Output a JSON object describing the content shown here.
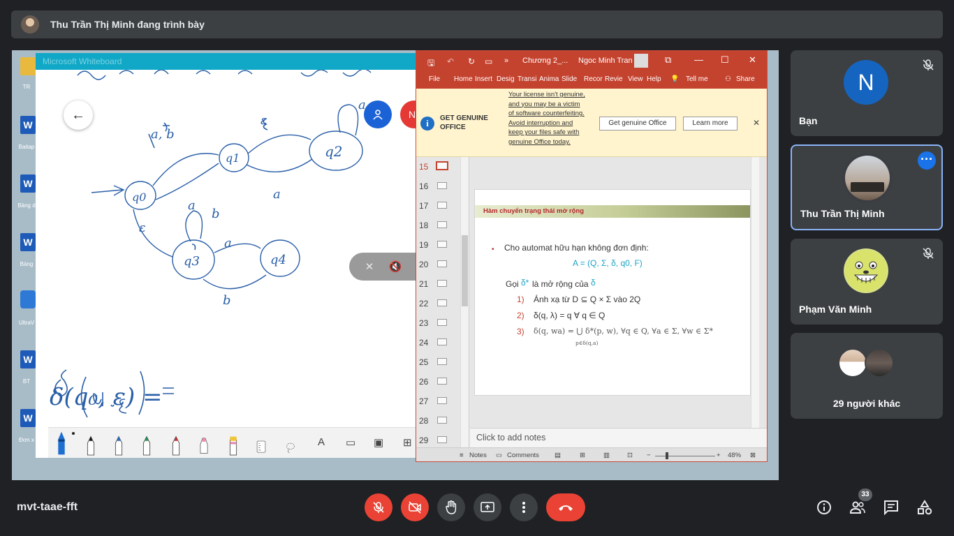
{
  "banner": {
    "presenter_text": "Thu Trần Thị Minh đang trình bày"
  },
  "desktop": {
    "icons": [
      {
        "label": "TR",
        "type": "folder"
      },
      {
        "label": "Baitap",
        "type": "word"
      },
      {
        "label": "Bảng d",
        "type": "word"
      },
      {
        "label": "Bảng",
        "type": "word"
      },
      {
        "label": "UltraV",
        "type": "app"
      },
      {
        "label": "BT",
        "type": "word"
      },
      {
        "label": "Đơn x",
        "type": "word"
      }
    ]
  },
  "whiteboard": {
    "title": "Microsoft Whiteboard",
    "user_initial": "N",
    "math_expression": "δ(q₀, ε) =",
    "state_labels": [
      "q0",
      "q1",
      "q2",
      "q3",
      "q4"
    ],
    "edge_labels": [
      "a, b",
      "ε",
      "a",
      "a",
      "ε",
      "b",
      "a",
      "b",
      "a"
    ]
  },
  "presenter_controls": {
    "icons": [
      "cursor-off-icon",
      "sound-off-icon",
      "camera-off-icon"
    ]
  },
  "powerpoint": {
    "title": "Chương 2_...",
    "account": "Ngoc Minh Tran",
    "menu": [
      "File",
      "Home",
      "Insert",
      "Desig",
      "Transi",
      "Anima",
      "Slide",
      "Recor",
      "Revie",
      "View",
      "Help"
    ],
    "tell_me": "Tell me",
    "share": "Share",
    "license": {
      "heading": "GET GENUINE OFFICE",
      "message": "Your license isn't genuine, and you may be a victim of software counterfeiting. Avoid interruption and keep your files safe with genuine Office today.",
      "get_button": "Get genuine Office",
      "learn_button": "Learn more"
    },
    "slide_numbers": [
      "15",
      "16",
      "17",
      "18",
      "19",
      "20",
      "21",
      "22",
      "23",
      "24",
      "25",
      "26",
      "27",
      "28",
      "29"
    ],
    "selected_slide": "15",
    "slide": {
      "heading": "Hàm chuyển trạng thái mở rộng",
      "bullet": "Cho automat hữu hạn không đơn định:",
      "tuple": "A = (Q, Σ, δ, q0, F)",
      "goi_prefix": "Gọi",
      "goi_suffix": "là mở rộng của",
      "delta_star": "δ*",
      "delta": "δ",
      "items": [
        {
          "num": "1)",
          "text": "Ánh xạ từ D ⊆ Q × Σ vào 2Q"
        },
        {
          "num": "2)",
          "text": "δ(q, λ) = q ∀ q ∈ Q"
        },
        {
          "num": "3)",
          "text": "δ(q, wa) = ⋃ δ*(p, w), ∀q ∈ Q, ∀a ∈ Σ, ∀w ∈ Σ*"
        }
      ],
      "union_subscript": "p∈δ(q,a)"
    },
    "notes_placeholder": "Click to add notes",
    "status": {
      "notes": "Notes",
      "comments": "Comments",
      "zoom": "48%"
    }
  },
  "participants": [
    {
      "name": "Bạn",
      "initial": "N",
      "muted": true
    },
    {
      "name": "Thu Trần Thị Minh",
      "presenting": true
    },
    {
      "name": "Phạm Văn Minh",
      "muted": true
    },
    {
      "name": "29 người khác"
    }
  ],
  "bottom": {
    "meeting_code": "mvt-taae-fft",
    "participant_count": "33"
  },
  "colors": {
    "accent": "#1a73e8",
    "end_call": "#ea4335",
    "ppt_red": "#c4432f",
    "background": "#202124"
  }
}
